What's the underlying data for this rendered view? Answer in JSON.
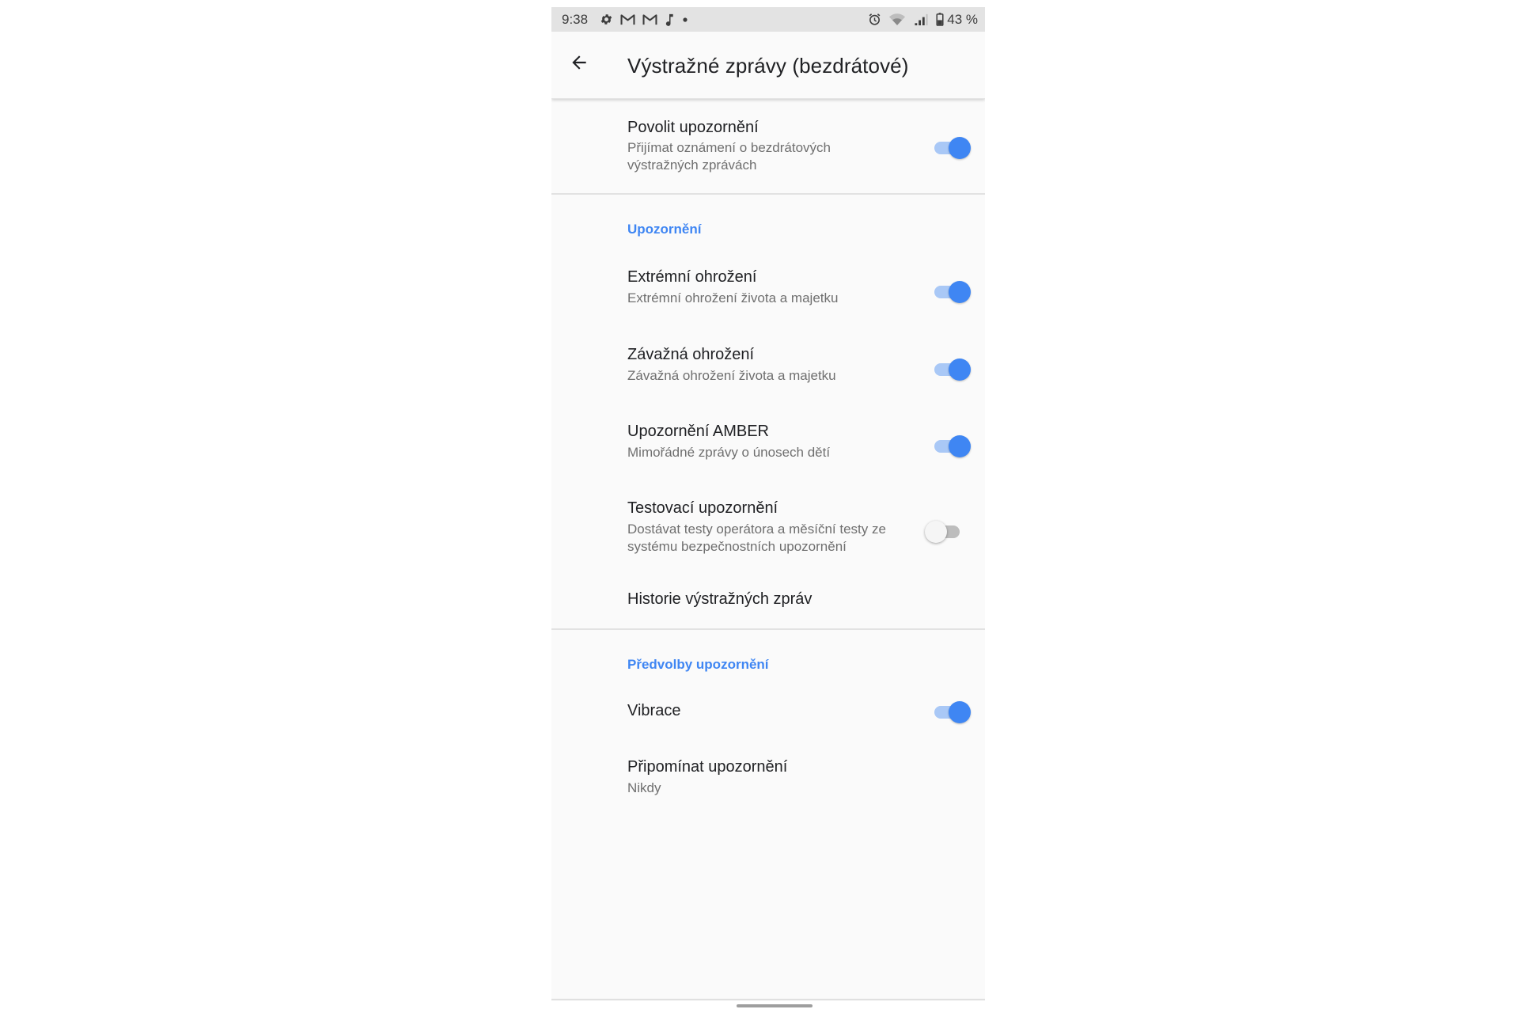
{
  "status_bar": {
    "time": "9:38",
    "battery": "43 %",
    "icons_left": [
      "settings-icon",
      "gmail-icon",
      "gmail-icon",
      "music-note-icon",
      "dot-icon"
    ],
    "icons_right": [
      "alarm-icon",
      "wifi-icon",
      "signal-icon",
      "battery-icon"
    ]
  },
  "app_bar": {
    "title": "Výstražné zprávy (bezdrátové)",
    "back_icon": "arrow-back-icon"
  },
  "master": {
    "title": "Povolit upozornění",
    "summary": "Přijímat oznámení o bezdrátových výstražných zprávách",
    "checked": true
  },
  "sections": {
    "alerts_header": "Upozornění",
    "prefs_header": "Předvolby upozornění"
  },
  "alerts": {
    "extreme": {
      "title": "Extrémní ohrožení",
      "summary": "Extrémní ohrožení života a majetku",
      "checked": true
    },
    "severe": {
      "title": "Závažná ohrožení",
      "summary": "Závažná ohrožení života a majetku",
      "checked": true
    },
    "amber": {
      "title": "Upozornění AMBER",
      "summary": "Mimořádné zprávy o únosech dětí",
      "checked": true
    },
    "test": {
      "title": "Testovací upozornění",
      "summary": "Dostávat testy operátora a měsíční testy ze systému bezpečnostních upozornění",
      "checked": false
    },
    "history": {
      "title": "Historie výstražných zpráv"
    }
  },
  "preferences": {
    "vibration": {
      "title": "Vibrace",
      "checked": true
    },
    "reminder": {
      "title": "Připomínat upozornění",
      "summary": "Nikdy"
    }
  },
  "colors": {
    "accent": "#3f86f3",
    "accent_track": "#a9c8f6",
    "background": "#fafafa",
    "status_bar": "#e3e3e3"
  }
}
